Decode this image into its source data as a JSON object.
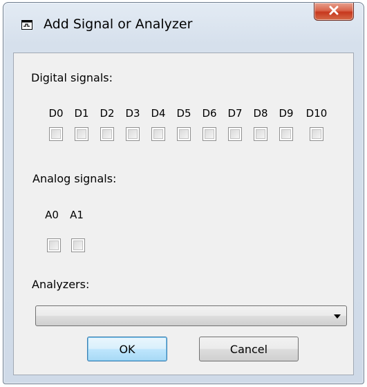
{
  "window": {
    "title": "Add Signal or Analyzer",
    "title_icon": "window-app-icon",
    "close_icon": "close-x-icon"
  },
  "digital": {
    "heading": "Digital signals:",
    "signals": [
      "D0",
      "D1",
      "D2",
      "D3",
      "D4",
      "D5",
      "D6",
      "D7",
      "D8",
      "D9",
      "D10"
    ]
  },
  "analog": {
    "heading": "Analog signals:",
    "signals": [
      "A0",
      "A1"
    ]
  },
  "analyzers": {
    "heading": "Analyzers:",
    "selected": ""
  },
  "buttons": {
    "ok": "OK",
    "cancel": "Cancel"
  },
  "colors": {
    "close_button": "#c7381e",
    "default_button_border": "#3c7fb1",
    "frame": "#cfdae8"
  }
}
